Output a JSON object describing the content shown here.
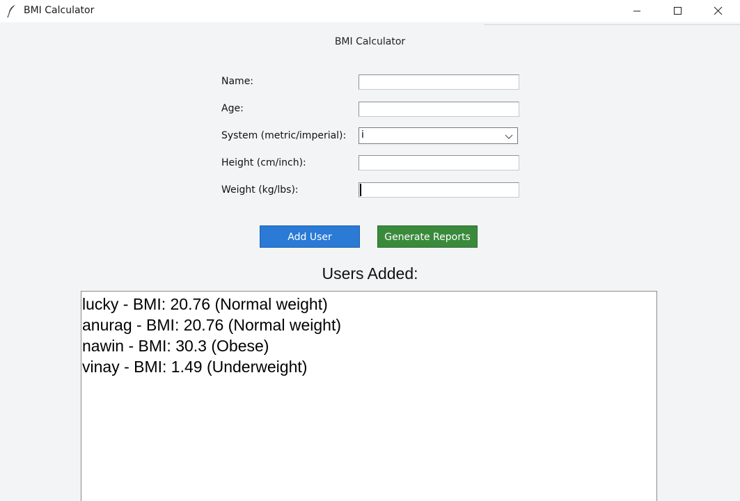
{
  "window": {
    "title": "BMI Calculator",
    "controls": {
      "minimize_icon": "minimize-icon",
      "maximize_icon": "maximize-icon",
      "close_icon": "close-icon"
    }
  },
  "form": {
    "heading": "BMI Calculator",
    "fields": [
      {
        "label": "Name:",
        "value": ""
      },
      {
        "label": "Age:",
        "value": ""
      },
      {
        "label": "System (metric/imperial):",
        "value": "i"
      },
      {
        "label": "Height (cm/inch):",
        "value": ""
      },
      {
        "label": "Weight (kg/lbs):",
        "value": ""
      }
    ]
  },
  "buttons": {
    "add_user": "Add User",
    "generate_reports": "Generate Reports",
    "add_user_color": "#2a7ad6",
    "generate_reports_color": "#3a8a3c"
  },
  "users": {
    "heading": "Users Added:",
    "items": [
      "lucky - BMI: 20.76 (Normal weight)",
      "anurag - BMI: 20.76 (Normal weight)",
      "nawin - BMI: 30.3 (Obese)",
      "vinay - BMI: 1.49 (Underweight)"
    ]
  }
}
